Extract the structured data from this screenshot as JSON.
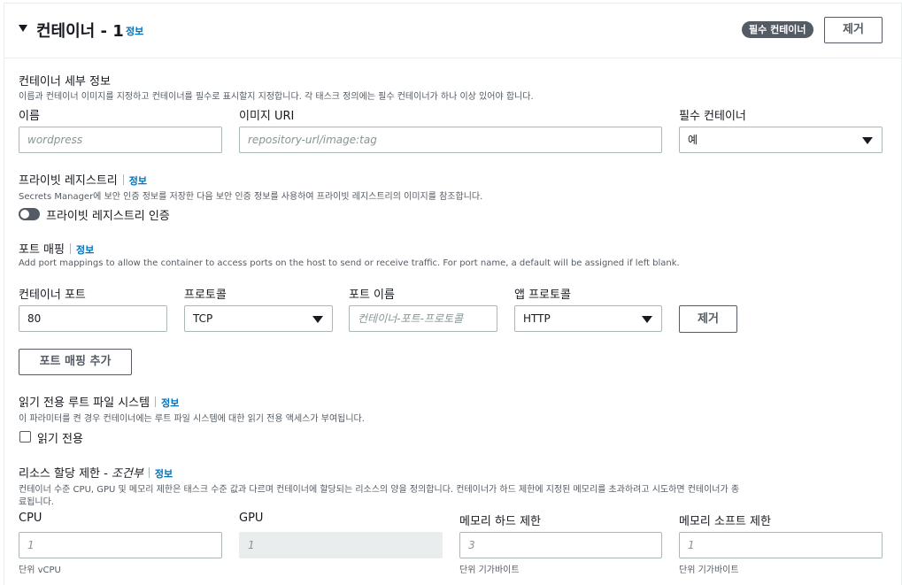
{
  "header": {
    "title": "컨테이너 - 1",
    "info": "정보",
    "badge": "필수 컨테이너",
    "remove_label": "제거"
  },
  "details": {
    "title": "컨테이너 세부 정보",
    "desc": "이름과 컨테이너 이미지를 지정하고 컨테이너를 필수로 표시할지 지정합니다. 각 태스크 정의에는 필수 컨테이너가 하나 이상 있어야 합니다.",
    "name_label": "이름",
    "name_placeholder": "wordpress",
    "image_label": "이미지 URI",
    "image_placeholder": "repository-url/image:tag",
    "essential_label": "필수 컨테이너",
    "essential_value": "예"
  },
  "registry": {
    "title": "프라이빗 레지스트리",
    "info": "정보",
    "desc": "Secrets Manager에 보안 인증 정보를 저장한 다음 보안 인증 정보를 사용하여 프라이빗 레지스트리의 이미지를 참조합니다.",
    "toggle_label": "프라이빗 레지스트리 인증"
  },
  "ports": {
    "title": "포트 매핑",
    "info": "정보",
    "desc": "Add port mappings to allow the container to access ports on the host to send or receive traffic. For port name, a default will be assigned if left blank.",
    "container_port_label": "컨테이너 포트",
    "container_port_value": "80",
    "protocol_label": "프로토콜",
    "protocol_value": "TCP",
    "port_name_label": "포트 이름",
    "port_name_placeholder": "컨테이너-포트-프로토콜",
    "app_protocol_label": "앱 프로토콜",
    "app_protocol_value": "HTTP",
    "remove_label": "제거",
    "add_label": "포트 매핑 추가"
  },
  "readonly": {
    "title": "읽기 전용 루트 파일 시스템",
    "info": "정보",
    "desc": "이 파라미터를 켠 경우 컨테이너에는 루트 파일 시스템에 대한 읽기 전용 액세스가 부여됩니다.",
    "checkbox_label": "읽기 전용"
  },
  "resources": {
    "title": "리소스 할당 제한 - ",
    "title_optional": "조건부",
    "info": "정보",
    "desc_line1": "컨테이너 수준 CPU, GPU 및 메모리 제한은 태스크 수준 값과 다르며 컨테이너에 할당되는 리소스의 양을 정의합니다. 컨테이너가 하드 제한에 지정된 메모리를 초과하려고 시도하면 컨테이너가 종",
    "desc_line2": "료됩니다.",
    "cpu_label": "CPU",
    "cpu_placeholder": "1",
    "cpu_hint": "단위 vCPU",
    "gpu_label": "GPU",
    "gpu_placeholder": "1",
    "mem_hard_label": "메모리 하드 제한",
    "mem_hard_placeholder": "3",
    "mem_hard_hint": "단위 기가바이트",
    "mem_soft_label": "메모리 소프트 제한",
    "mem_soft_placeholder": "1",
    "mem_soft_hint": "단위 기가바이트"
  }
}
